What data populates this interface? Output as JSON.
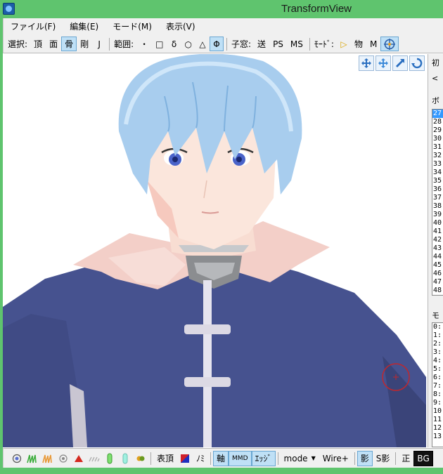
{
  "window": {
    "title": "TransformView"
  },
  "menu": [
    "ファイル(F)",
    "編集(E)",
    "モード(M)",
    "表示(V)"
  ],
  "toolbar": {
    "select_label": "選択:",
    "select_buttons": [
      {
        "label": "頂",
        "active": false
      },
      {
        "label": "面",
        "active": false
      },
      {
        "label": "骨",
        "active": true
      },
      {
        "label": "剛",
        "active": false
      },
      {
        "label": "J",
        "active": false
      }
    ],
    "range_label": "範囲:",
    "range_buttons": [
      {
        "label": "・",
        "active": false
      },
      {
        "label": "□",
        "active": false
      },
      {
        "label": "δ",
        "active": false
      },
      {
        "label": "○",
        "active": false
      },
      {
        "label": "△",
        "active": false
      },
      {
        "label": "Φ",
        "active": true
      }
    ],
    "child_label": "子窓:",
    "child_buttons": [
      "送",
      "PS",
      "MS"
    ],
    "mode_label": "ﾓｰﾄﾞ:",
    "mode_buttons": [
      "▷",
      "物",
      "M"
    ]
  },
  "right_panel": {
    "top_tab": "ボ",
    "top_tab_prev": "<",
    "top_tab_label": "初",
    "bone_rows": [
      "27",
      "28",
      "29",
      "30",
      "31",
      "32",
      "33",
      "34",
      "35",
      "36",
      "37",
      "38",
      "39",
      "40",
      "41",
      "42",
      "43",
      "44",
      "45",
      "46",
      "47",
      "48"
    ],
    "selected_row": 0,
    "second_title": "モ",
    "morph_rows": [
      "0:",
      "1:",
      "2:",
      "3:",
      "4:",
      "5:",
      "6:",
      "7:",
      "8:",
      "9:",
      "10",
      "11",
      "12",
      "13"
    ]
  },
  "statusbar": {
    "face_label": "表頂",
    "no_label": "ﾉﾐ",
    "axis_label": "軸",
    "mmd_label": "MMD",
    "edge_label": "ｴｯｼﾞ",
    "mode_select": "mode",
    "wire_label": "Wire+",
    "shadow_label": "影",
    "sshadow_label": "S影",
    "front_label": "正",
    "bg_label": "BG"
  },
  "colors": {
    "titlebar": "#5fc46e",
    "hair": "#a8cdee",
    "jacket": "#46528f",
    "skin": "#fbe6dc",
    "collar": "#f3cfc8",
    "accent_active": "#bfe0f6"
  }
}
